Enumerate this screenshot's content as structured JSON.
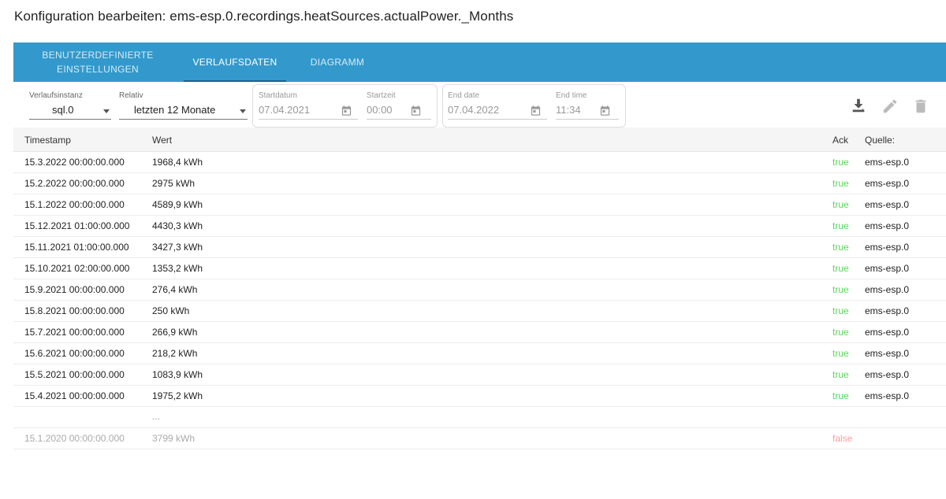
{
  "title": "Konfiguration bearbeiten: ems-esp.0.recordings.heatSources.actualPower._Months",
  "tabs": {
    "custom_line1": "BENUTZERDEFINIERTE",
    "custom_line2": "EINSTELLUNGEN",
    "history": "VERLAUFSDATEN",
    "diagram": "DIAGRAMM"
  },
  "filters": {
    "instance_label": "Verlaufsinstanz",
    "instance_value": "sql.0",
    "relative_label": "Relativ",
    "relative_value": "letzten 12 Monate",
    "start_date_label": "Startdatum",
    "start_date_value": "07.04.2021",
    "start_time_label": "Startzeit",
    "start_time_value": "00:00",
    "end_date_label": "End date",
    "end_date_value": "07.04.2022",
    "end_time_label": "End time",
    "end_time_value": "11:34"
  },
  "toolbar_icons": [
    "download-icon",
    "edit-icon",
    "delete-icon"
  ],
  "table": {
    "headers": {
      "timestamp": "Timestamp",
      "value": "Wert",
      "ack": "Ack",
      "source": "Quelle:"
    },
    "rows": [
      {
        "ts": "15.3.2022 00:00:00.000",
        "val": "1968,4 kWh",
        "ack": "true",
        "src": "ems-esp.0"
      },
      {
        "ts": "15.2.2022 00:00:00.000",
        "val": "2975 kWh",
        "ack": "true",
        "src": "ems-esp.0"
      },
      {
        "ts": "15.1.2022 00:00:00.000",
        "val": "4589,9 kWh",
        "ack": "true",
        "src": "ems-esp.0"
      },
      {
        "ts": "15.12.2021 01:00:00.000",
        "val": "4430,3 kWh",
        "ack": "true",
        "src": "ems-esp.0"
      },
      {
        "ts": "15.11.2021 01:00:00.000",
        "val": "3427,3 kWh",
        "ack": "true",
        "src": "ems-esp.0"
      },
      {
        "ts": "15.10.2021 02:00:00.000",
        "val": "1353,2 kWh",
        "ack": "true",
        "src": "ems-esp.0"
      },
      {
        "ts": "15.9.2021 00:00:00.000",
        "val": "276,4 kWh",
        "ack": "true",
        "src": "ems-esp.0"
      },
      {
        "ts": "15.8.2021 00:00:00.000",
        "val": "250 kWh",
        "ack": "true",
        "src": "ems-esp.0"
      },
      {
        "ts": "15.7.2021 00:00:00.000",
        "val": "266,9 kWh",
        "ack": "true",
        "src": "ems-esp.0"
      },
      {
        "ts": "15.6.2021 00:00:00.000",
        "val": "218,2 kWh",
        "ack": "true",
        "src": "ems-esp.0"
      },
      {
        "ts": "15.5.2021 00:00:00.000",
        "val": "1083,9 kWh",
        "ack": "true",
        "src": "ems-esp.0"
      },
      {
        "ts": "15.4.2021 00:00:00.000",
        "val": "1975,2 kWh",
        "ack": "true",
        "src": "ems-esp.0"
      }
    ],
    "ellipsis": "...",
    "extra_row": {
      "ts": "15.1.2020 00:00:00.000",
      "val": "3799 kWh",
      "ack": "false",
      "src": ""
    }
  },
  "colors": {
    "tabbar": "#3399cc",
    "ack_true": "#5cd65c",
    "ack_false": "#f2a0a0"
  }
}
